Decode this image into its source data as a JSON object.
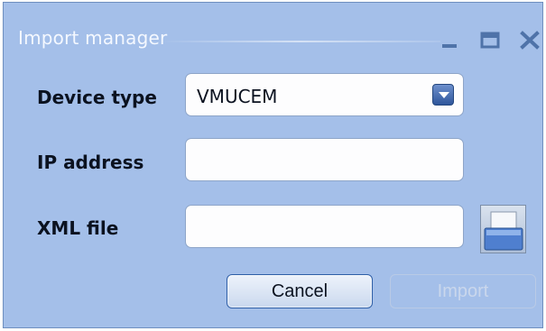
{
  "window": {
    "title": "Import manager",
    "controls": {
      "minimize": "minimize-icon",
      "maximize": "maximize-icon",
      "close": "close-icon"
    }
  },
  "form": {
    "device_type_label": "Device type",
    "device_type_value": "VMUCEM",
    "ip_address_label": "IP address",
    "ip_address_value": "",
    "xml_file_label": "XML file",
    "xml_file_value": ""
  },
  "buttons": {
    "cancel": "Cancel",
    "import": "Import"
  },
  "colors": {
    "window_bg": "#a4bfe9",
    "title_text": "#f4f8ff",
    "dropdown_arrow": "#3f63a6",
    "import_disabled_text": "#cad7ec"
  }
}
